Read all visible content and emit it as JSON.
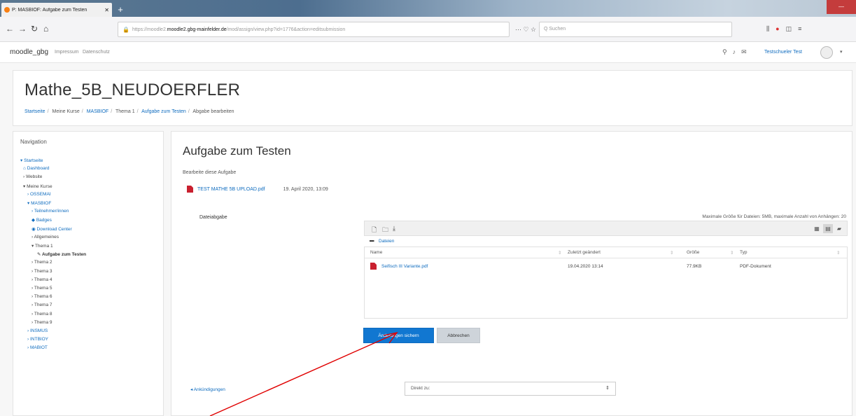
{
  "browser": {
    "tab_title": "P: MASBIOF: Aufgabe zum Testen",
    "tab_close": "✕",
    "new_tab": "+",
    "window_button": "—",
    "url_host": "moodle2.gbg-mainfelder.de",
    "url_prefix": "https://moodle2.",
    "url_rest": "/mod/assign/view.php?id=1776&action=editsubmission",
    "url_icons": "··· ♡ ☆",
    "search_placeholder": "Q Suchen",
    "back": "←",
    "forward": "→",
    "reload": "↻",
    "home": "⌂"
  },
  "moodle_nav": {
    "brand": "moodle_gbg",
    "links": [
      "Impressum",
      "Datenschutz"
    ],
    "user_name": "Testschueler Test",
    "caret": "▾"
  },
  "course": {
    "title": "Mathe_5B_NEUDOERFLER",
    "breadcrumb": [
      "Startseite",
      "Meine Kurse",
      "MASBIOF",
      "Thema 1",
      "Aufgabe zum Testen",
      "Abgabe bearbeiten"
    ]
  },
  "navigation": {
    "heading": "Navigation",
    "items": [
      {
        "label": "▾ Startseite",
        "kind": "link"
      },
      {
        "label": "Dashboard",
        "kind": "link",
        "icon": "home-icon"
      },
      {
        "label": "› Website",
        "kind": "plain"
      },
      {
        "label": "▾ Meine Kurse",
        "kind": "plain"
      },
      {
        "label": "› OSSEMAI",
        "kind": "link"
      },
      {
        "label": "▾ MASBIOF",
        "kind": "link"
      },
      {
        "label": "› Teilnehmer/innen",
        "kind": "link"
      },
      {
        "label": "Badges",
        "kind": "link",
        "icon": "badge-icon"
      },
      {
        "label": "Download Center",
        "kind": "link",
        "icon": "download-icon"
      },
      {
        "label": "› Allgemeines",
        "kind": "plain"
      },
      {
        "label": "▾ Thema 1",
        "kind": "plain"
      },
      {
        "label": "Aufgabe zum Testen",
        "kind": "active",
        "icon": "assignment-icon"
      },
      {
        "label": "› Thema 2",
        "kind": "plain"
      },
      {
        "label": "› Thema 3",
        "kind": "plain"
      },
      {
        "label": "› Thema 4",
        "kind": "plain"
      },
      {
        "label": "› Thema 5",
        "kind": "plain"
      },
      {
        "label": "› Thema 6",
        "kind": "plain"
      },
      {
        "label": "› Thema 7",
        "kind": "plain"
      },
      {
        "label": "› Thema 8",
        "kind": "plain"
      },
      {
        "label": "› Thema 9",
        "kind": "plain"
      },
      {
        "label": "› INSMUS",
        "kind": "link"
      },
      {
        "label": "› INTBIOY",
        "kind": "link"
      },
      {
        "label": "› MABIOT",
        "kind": "link"
      }
    ]
  },
  "assignment": {
    "title": "Aufgabe zum Testen",
    "subtitle": "Bearbeite diese Aufgabe",
    "attached_file": "TEST MATHE 5B UPLOAD.pdf",
    "attached_date": "19. April 2020, 13:09",
    "file_label": "Dateiabgabe",
    "limits": "Maximale Größe für Dateien: 5MB, maximale Anzahl von Anhängen: 20",
    "path_label": "Dateien",
    "columns": [
      "Name",
      "Zuletzt geändert",
      "Größe",
      "Typ"
    ],
    "files": [
      {
        "name": "Seifisch III Variante.pdf",
        "modified": "19.04.2020 13:14",
        "size": "77.9KB",
        "type": "PDF-Dokument"
      }
    ],
    "save_label": "Änderungen sichern",
    "cancel_label": "Abbrechen"
  },
  "footer_nav": {
    "jump_link": "◂ Ankündigungen",
    "jump_select": "Direkt zu:",
    "select_arrow": "⇕"
  },
  "colors": {
    "link": "#0f6cbf",
    "primary_button": "#1177d1",
    "annotation_arrow": "#e00000"
  }
}
